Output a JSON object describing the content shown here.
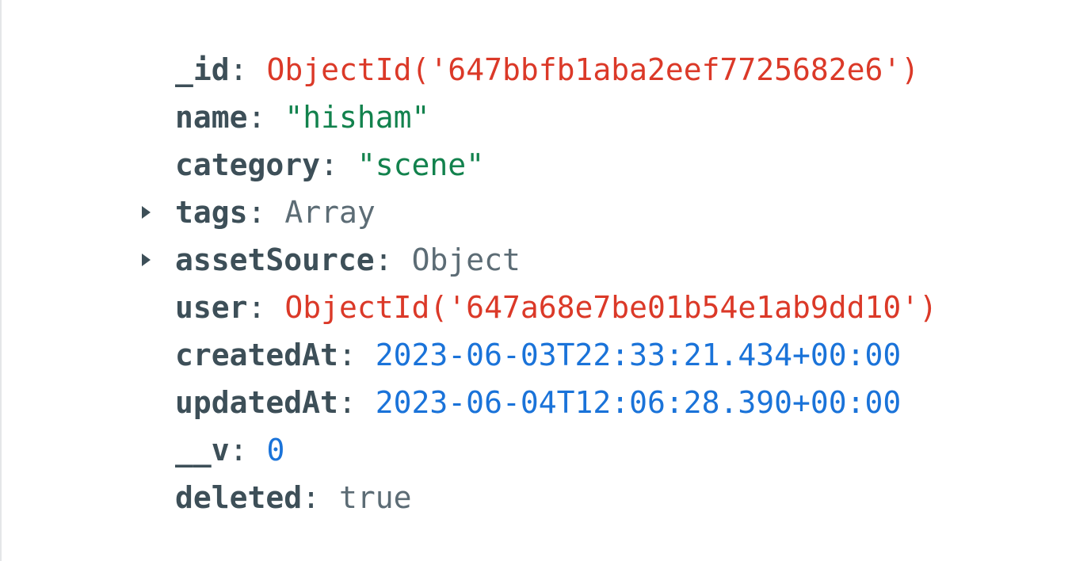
{
  "document": {
    "fields": [
      {
        "key": "_id",
        "value": "ObjectId('647bbfb1aba2eef7725682e6')",
        "type": "objectid",
        "expandable": false
      },
      {
        "key": "name",
        "value": "\"hisham\"",
        "type": "string",
        "expandable": false
      },
      {
        "key": "category",
        "value": "\"scene\"",
        "type": "string",
        "expandable": false
      },
      {
        "key": "tags",
        "value": "Array",
        "type": "type",
        "expandable": true
      },
      {
        "key": "assetSource",
        "value": "Object",
        "type": "type",
        "expandable": true
      },
      {
        "key": "user",
        "value": "ObjectId('647a68e7be01b54e1ab9dd10')",
        "type": "objectid",
        "expandable": false
      },
      {
        "key": "createdAt",
        "value": "2023-06-03T22:33:21.434+00:00",
        "type": "date",
        "expandable": false
      },
      {
        "key": "updatedAt",
        "value": "2023-06-04T12:06:28.390+00:00",
        "type": "date",
        "expandable": false
      },
      {
        "key": "__v",
        "value": "0",
        "type": "number",
        "expandable": false
      },
      {
        "key": "deleted",
        "value": "true",
        "type": "bool",
        "expandable": false
      }
    ],
    "separator": ":"
  },
  "colors": {
    "key": "#3d4f58",
    "objectid": "#db3928",
    "string": "#12824d",
    "date": "#1a73d9",
    "number": "#1a73d9",
    "type": "#5c6c75",
    "bool": "#5c6c75"
  }
}
